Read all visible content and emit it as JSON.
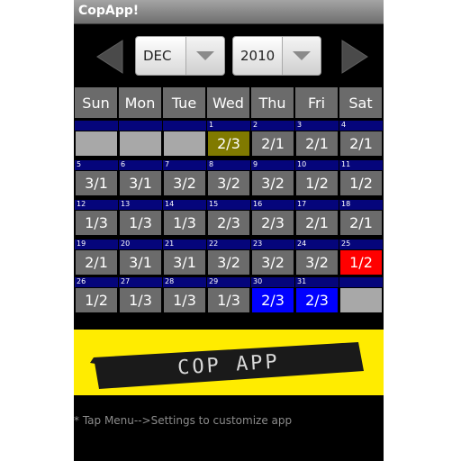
{
  "app": {
    "title": "CopApp!"
  },
  "controls": {
    "month": "DEC",
    "year": "2010"
  },
  "weekdays": [
    "Sun",
    "Mon",
    "Tue",
    "Wed",
    "Thu",
    "Fri",
    "Sat"
  ],
  "calendar": {
    "week1": [
      {
        "date": "",
        "value": "",
        "style": "empty"
      },
      {
        "date": "",
        "value": "",
        "style": "empty"
      },
      {
        "date": "",
        "value": "",
        "style": "empty"
      },
      {
        "date": "1",
        "value": "2/3",
        "style": "today"
      },
      {
        "date": "2",
        "value": "2/1",
        "style": "normal"
      },
      {
        "date": "3",
        "value": "2/1",
        "style": "normal"
      },
      {
        "date": "4",
        "value": "2/1",
        "style": "normal"
      }
    ],
    "week2": [
      {
        "date": "5",
        "value": "3/1",
        "style": "normal"
      },
      {
        "date": "6",
        "value": "3/1",
        "style": "normal"
      },
      {
        "date": "7",
        "value": "3/2",
        "style": "normal"
      },
      {
        "date": "8",
        "value": "3/2",
        "style": "normal"
      },
      {
        "date": "9",
        "value": "3/2",
        "style": "normal"
      },
      {
        "date": "10",
        "value": "1/2",
        "style": "normal"
      },
      {
        "date": "11",
        "value": "1/2",
        "style": "normal"
      }
    ],
    "week3": [
      {
        "date": "12",
        "value": "1/3",
        "style": "normal"
      },
      {
        "date": "13",
        "value": "1/3",
        "style": "normal"
      },
      {
        "date": "14",
        "value": "1/3",
        "style": "normal"
      },
      {
        "date": "15",
        "value": "2/3",
        "style": "normal"
      },
      {
        "date": "16",
        "value": "2/3",
        "style": "normal"
      },
      {
        "date": "17",
        "value": "2/1",
        "style": "normal"
      },
      {
        "date": "18",
        "value": "2/1",
        "style": "normal"
      }
    ],
    "week4": [
      {
        "date": "19",
        "value": "2/1",
        "style": "normal"
      },
      {
        "date": "20",
        "value": "3/1",
        "style": "normal"
      },
      {
        "date": "21",
        "value": "3/1",
        "style": "normal"
      },
      {
        "date": "22",
        "value": "3/2",
        "style": "normal"
      },
      {
        "date": "23",
        "value": "3/2",
        "style": "normal"
      },
      {
        "date": "24",
        "value": "3/2",
        "style": "normal"
      },
      {
        "date": "25",
        "value": "1/2",
        "style": "red"
      }
    ],
    "week5": [
      {
        "date": "26",
        "value": "1/2",
        "style": "normal"
      },
      {
        "date": "27",
        "value": "1/3",
        "style": "normal"
      },
      {
        "date": "28",
        "value": "1/3",
        "style": "normal"
      },
      {
        "date": "29",
        "value": "1/3",
        "style": "normal"
      },
      {
        "date": "30",
        "value": "2/3",
        "style": "blue"
      },
      {
        "date": "31",
        "value": "2/3",
        "style": "blue"
      },
      {
        "date": "",
        "value": "",
        "style": "empty"
      }
    ]
  },
  "banner": {
    "text": "COP APP"
  },
  "footer": {
    "hint": "* Tap Menu-->Settings to customize app"
  },
  "colors": {
    "background": "#000000",
    "cell": "#6b6b6b",
    "date_strip": "#05057b",
    "today": "#807a00",
    "highlight_red": "#ff0000",
    "highlight_blue": "#0000ff",
    "banner": "#ffec00"
  },
  "icons": {
    "prev": "left-arrow-icon",
    "next": "right-arrow-icon",
    "dropdown": "chevron-down-icon"
  }
}
